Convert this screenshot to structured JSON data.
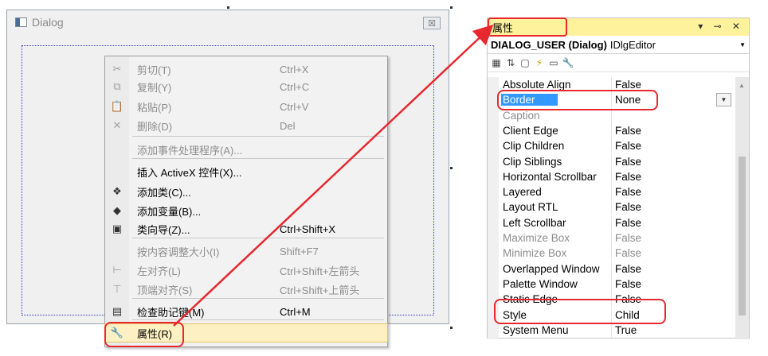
{
  "dialog": {
    "title": "Dialog",
    "close_glyph": "☒"
  },
  "menu": {
    "items": [
      {
        "label": "剪切(T)",
        "shortcut": "Ctrl+X",
        "icon": "cut-icon",
        "glyph": "✂",
        "state": "disabled"
      },
      {
        "label": "复制(Y)",
        "shortcut": "Ctrl+C",
        "icon": "copy-icon",
        "glyph": "⧉",
        "state": "disabled"
      },
      {
        "label": "粘贴(P)",
        "shortcut": "Ctrl+V",
        "icon": "paste-icon",
        "glyph": "📋",
        "state": "disabled"
      },
      {
        "label": "删除(D)",
        "shortcut": "Del",
        "icon": "delete-icon",
        "glyph": "✕",
        "state": "disabled"
      },
      {
        "label": "添加事件处理程序(A)...",
        "shortcut": "",
        "icon": "",
        "glyph": "",
        "state": "disabled"
      },
      {
        "label": "插入 ActiveX 控件(X)...",
        "shortcut": "",
        "icon": "",
        "glyph": "",
        "state": "enabled"
      },
      {
        "label": "添加类(C)...",
        "shortcut": "",
        "icon": "add-class-icon",
        "glyph": "❖",
        "state": "enabled"
      },
      {
        "label": "添加变量(B)...",
        "shortcut": "",
        "icon": "add-variable-icon",
        "glyph": "◆",
        "state": "enabled"
      },
      {
        "label": "类向导(Z)...",
        "shortcut": "Ctrl+Shift+X",
        "icon": "class-wizard-icon",
        "glyph": "▣",
        "state": "enabled"
      },
      {
        "label": "按内容调整大小(I)",
        "shortcut": "Shift+F7",
        "icon": "",
        "glyph": "",
        "state": "disabled"
      },
      {
        "label": "左对齐(L)",
        "shortcut": "Ctrl+Shift+左箭头",
        "icon": "align-left-icon",
        "glyph": "⊢",
        "state": "disabled"
      },
      {
        "label": "顶端对齐(S)",
        "shortcut": "Ctrl+Shift+上箭头",
        "icon": "align-top-icon",
        "glyph": "⊤",
        "state": "disabled"
      },
      {
        "label": "检查助记键(M)",
        "shortcut": "Ctrl+M",
        "icon": "check-mnemonics-icon",
        "glyph": "▤",
        "state": "enabled"
      },
      {
        "label": "属性(R)",
        "shortcut": "",
        "icon": "wrench-icon",
        "glyph": "🔧",
        "state": "highlight"
      }
    ]
  },
  "props": {
    "header": "属性",
    "header_buttons": "▾ ⊸ ✕",
    "object_name": "DIALOG_USER (Dialog)",
    "object_type": "IDlgEditor",
    "rows": [
      {
        "name": "Absolute Align",
        "value": "False",
        "dim": false
      },
      {
        "name": "Border",
        "value": "None",
        "dim": false,
        "selected": true
      },
      {
        "name": "Caption",
        "value": "",
        "dim": true
      },
      {
        "name": "Client Edge",
        "value": "False",
        "dim": false
      },
      {
        "name": "Clip Children",
        "value": "False",
        "dim": false
      },
      {
        "name": "Clip Siblings",
        "value": "False",
        "dim": false
      },
      {
        "name": "Horizontal Scrollbar",
        "value": "False",
        "dim": false
      },
      {
        "name": "Layered",
        "value": "False",
        "dim": false
      },
      {
        "name": "Layout RTL",
        "value": "False",
        "dim": false
      },
      {
        "name": "Left Scrollbar",
        "value": "False",
        "dim": false
      },
      {
        "name": "Maximize Box",
        "value": "False",
        "dim": true
      },
      {
        "name": "Minimize Box",
        "value": "False",
        "dim": true
      },
      {
        "name": "Overlapped Window",
        "value": "False",
        "dim": false
      },
      {
        "name": "Palette Window",
        "value": "False",
        "dim": false
      },
      {
        "name": "Static Edge",
        "value": "False",
        "dim": false
      },
      {
        "name": "Style",
        "value": "Child",
        "dim": false
      },
      {
        "name": "System Menu",
        "value": "True",
        "dim": false
      }
    ]
  },
  "colors": {
    "annotation": "#e8282f",
    "props_header": "#fff29d",
    "selection": "#3399ff",
    "menu_highlight": "#fdf1c3"
  }
}
